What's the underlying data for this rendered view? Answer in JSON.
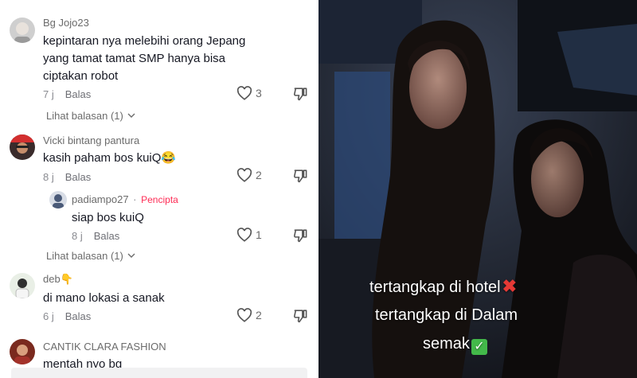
{
  "comments": [
    {
      "username": "Bg Jojo23",
      "text": "kepintaran nya melebihi orang Jepang yang tamat tamat SMP hanya bisa ciptakan robot",
      "time": "7 j",
      "reply_label": "Balas",
      "likes": "3",
      "view_replies": "Lihat balasan (1)"
    },
    {
      "username": "Vicki bintang pantura",
      "text": "kasih paham bos kuiQ😂",
      "time": "8 j",
      "reply_label": "Balas",
      "likes": "2",
      "reply": {
        "username": "padiampo27",
        "creator_label": "Pencipta",
        "text": "siap bos kuiQ",
        "time": "8 j",
        "reply_label": "Balas",
        "likes": "1"
      },
      "view_replies": "Lihat balasan (1)"
    },
    {
      "username": "deb👇",
      "text": "di mano lokasi a sanak",
      "time": "6 j",
      "reply_label": "Balas",
      "likes": "2"
    },
    {
      "username": "CANTIK CLARA FASHION",
      "text": "mentah nyo bg"
    }
  ],
  "video": {
    "caption_line1": "tertangkap di hotel",
    "caption_line2": "tertangkap di Dalam",
    "caption_line3": "semak",
    "check_mark": "✓",
    "cross_mark": "✖"
  },
  "icons": {
    "like": "heart-outline-icon",
    "dislike": "thumbs-down-icon",
    "expand": "chevron-down-icon"
  }
}
